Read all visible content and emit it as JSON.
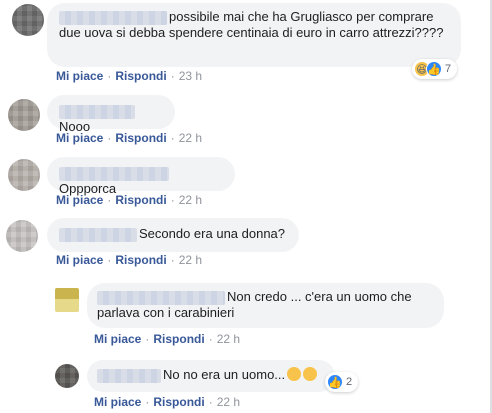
{
  "comments": [
    {
      "text": "possibile mai che ha Grugliasco per comprare due uova si debba spendere centinaia di euro in carro attrezzi????",
      "like_label": "Mi piace",
      "reply_label": "Rispondi",
      "time": "23 h",
      "reaction_count": "7",
      "reactions": [
        "haha-icon",
        "like-icon"
      ]
    },
    {
      "text": "Nooo",
      "like_label": "Mi piace",
      "reply_label": "Rispondi",
      "time": "22 h"
    },
    {
      "text": "Oppporca",
      "like_label": "Mi piace",
      "reply_label": "Rispondi",
      "time": "22 h"
    },
    {
      "text": "Secondo era una donna?",
      "like_label": "Mi piace",
      "reply_label": "Rispondi",
      "time": "22 h"
    }
  ],
  "replies": [
    {
      "text": "Non credo ... c'era un uomo che parlava con i carabinieri",
      "like_label": "Mi piace",
      "reply_label": "Rispondi",
      "time": "22 h"
    },
    {
      "text": "No no era un uomo...",
      "like_label": "Mi piace",
      "reply_label": "Rispondi",
      "time": "22 h",
      "reaction_count": "2",
      "reactions": [
        "like-icon"
      ]
    }
  ],
  "action_separator": "·",
  "colors": {
    "bubble": "#f2f3f5",
    "link": "#385898",
    "muted": "#90949c"
  }
}
